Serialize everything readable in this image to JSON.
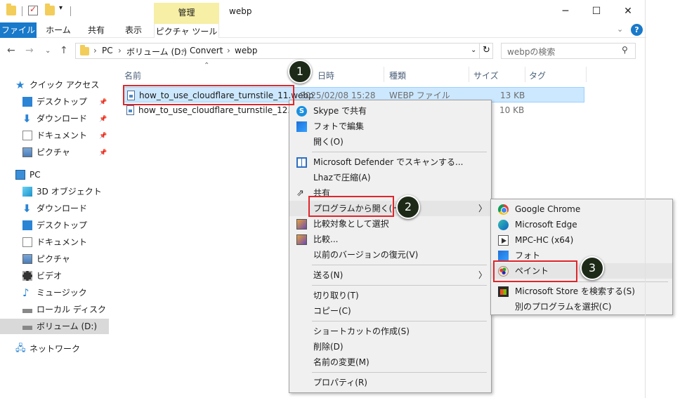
{
  "window": {
    "title": "webp",
    "context_tab": "管理",
    "help": "?"
  },
  "ribbon": {
    "tabs": [
      "ファイル",
      "ホーム",
      "共有",
      "表示",
      "ピクチャ ツール"
    ]
  },
  "address": {
    "segments": [
      "PC",
      "ボリューム (D:)",
      "Convert",
      "webp"
    ]
  },
  "search": {
    "placeholder": "webpの検索"
  },
  "nav": {
    "quick_access": "クイック アクセス",
    "quick_items": [
      "デスクトップ",
      "ダウンロード",
      "ドキュメント",
      "ピクチャ"
    ],
    "pc": "PC",
    "pc_items": [
      "3D オブジェクト",
      "ダウンロード",
      "デスクトップ",
      "ドキュメント",
      "ピクチャ",
      "ビデオ",
      "ミュージック",
      "ローカル ディスク (C:)",
      "ボリューム (D:)"
    ],
    "network": "ネットワーク"
  },
  "columns": [
    "名前",
    "日時",
    "種類",
    "サイズ",
    "タグ"
  ],
  "files": [
    {
      "name": "how_to_use_cloudflare_turnstile_11.webp",
      "date": "2025/02/08 15:28",
      "type": "WEBP ファイル",
      "size": "13 KB"
    },
    {
      "name": "how_to_use_cloudflare_turnstile_12.webp",
      "date": "",
      "type": "",
      "size": "10 KB"
    }
  ],
  "context_menu": {
    "items": [
      "Skype で共有",
      "フォトで編集",
      "開く(O)",
      "Microsoft Defender でスキャンする...",
      "Lhazで圧縮(A)",
      "共有",
      "プログラムから開く(H)",
      "比較対象として選択",
      "比較...",
      "以前のバージョンの復元(V)",
      "送る(N)",
      "切り取り(T)",
      "コピー(C)",
      "ショートカットの作成(S)",
      "削除(D)",
      "名前の変更(M)",
      "プロパティ(R)"
    ]
  },
  "submenu": {
    "items": [
      "Google Chrome",
      "Microsoft Edge",
      "MPC-HC (x64)",
      "フォト",
      "ペイント",
      "Microsoft Store を検索する(S)",
      "別のプログラムを選択(C)"
    ]
  },
  "badges": [
    "1",
    "2",
    "3"
  ],
  "colors": {
    "accent": "#1979ca",
    "selection": "#cce8ff",
    "annotation_red": "#e0262b",
    "badge_bg": "#1d2a18"
  }
}
